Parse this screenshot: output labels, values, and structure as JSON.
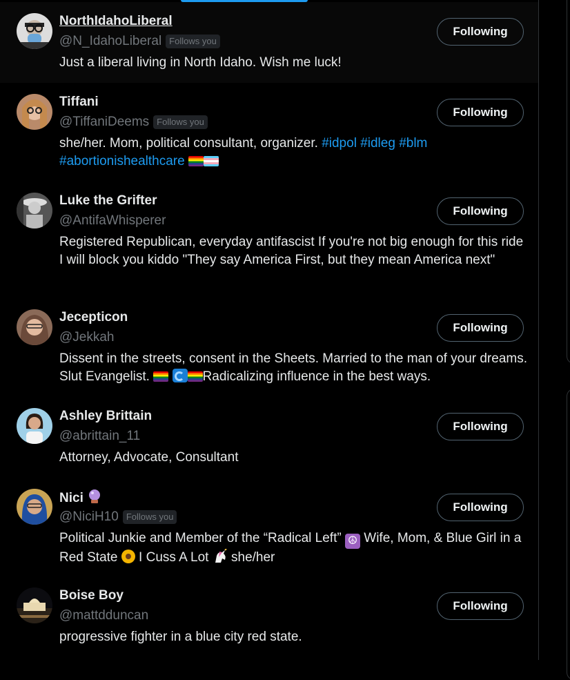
{
  "users": [
    {
      "display_name": "NorthIdahoLiberal",
      "handle": "@N_IdahoLiberal",
      "follows_you": "Follows you",
      "button_label": "Following",
      "bio": "Just a liberal living in North Idaho. Wish me luck!"
    },
    {
      "display_name": "Tiffani",
      "handle": "@TiffaniDeems",
      "follows_you": "Follows you",
      "button_label": "Following",
      "bio_text": "she/her. Mom, political consultant, organizer. ",
      "bio_tags": [
        "#idpol",
        "#idleg",
        "#blm",
        "#abortionishealthcare"
      ]
    },
    {
      "display_name": "Luke the Grifter",
      "handle": "@AntifaWhisperer",
      "button_label": "Following",
      "bio": "Registered Republican, everyday antifascist If you're not big enough for this ride I will block you kiddo \"They say America First, but they mean America next\""
    },
    {
      "display_name": "Jecepticon",
      "handle": "@Jekkah",
      "button_label": "Following",
      "bio_part1": "Dissent in the streets, consent in the Sheets. Married to the man of your dreams. Slut Evangelist. ",
      "bio_part2": "Radicalizing influence in the best ways."
    },
    {
      "display_name": "Ashley Brittain",
      "handle": "@abrittain_11",
      "button_label": "Following",
      "bio": "Attorney, Advocate, Consultant"
    },
    {
      "display_name": "Nici",
      "handle": "@NiciH10",
      "follows_you": "Follows you",
      "button_label": "Following",
      "bio_part1": "Political Junkie and Member of the “Radical Left” ",
      "bio_part2": " Wife, Mom, & Blue Girl in a Red State ",
      "bio_part3": " I Cuss A Lot ",
      "bio_part4": " she/her"
    },
    {
      "display_name": "Boise Boy",
      "handle": "@mattdduncan",
      "button_label": "Following",
      "bio": "progressive fighter in a blue city red state."
    }
  ],
  "colors": {
    "accent": "#1d9bf0",
    "secondary_text": "#71767b",
    "primary_text": "#e7e9ea",
    "border": "#2f3336"
  },
  "icons": [
    "rainbow-flag",
    "trans-flag",
    "wave",
    "peace-symbol",
    "sunflower",
    "unicorn",
    "crystal-ball"
  ]
}
